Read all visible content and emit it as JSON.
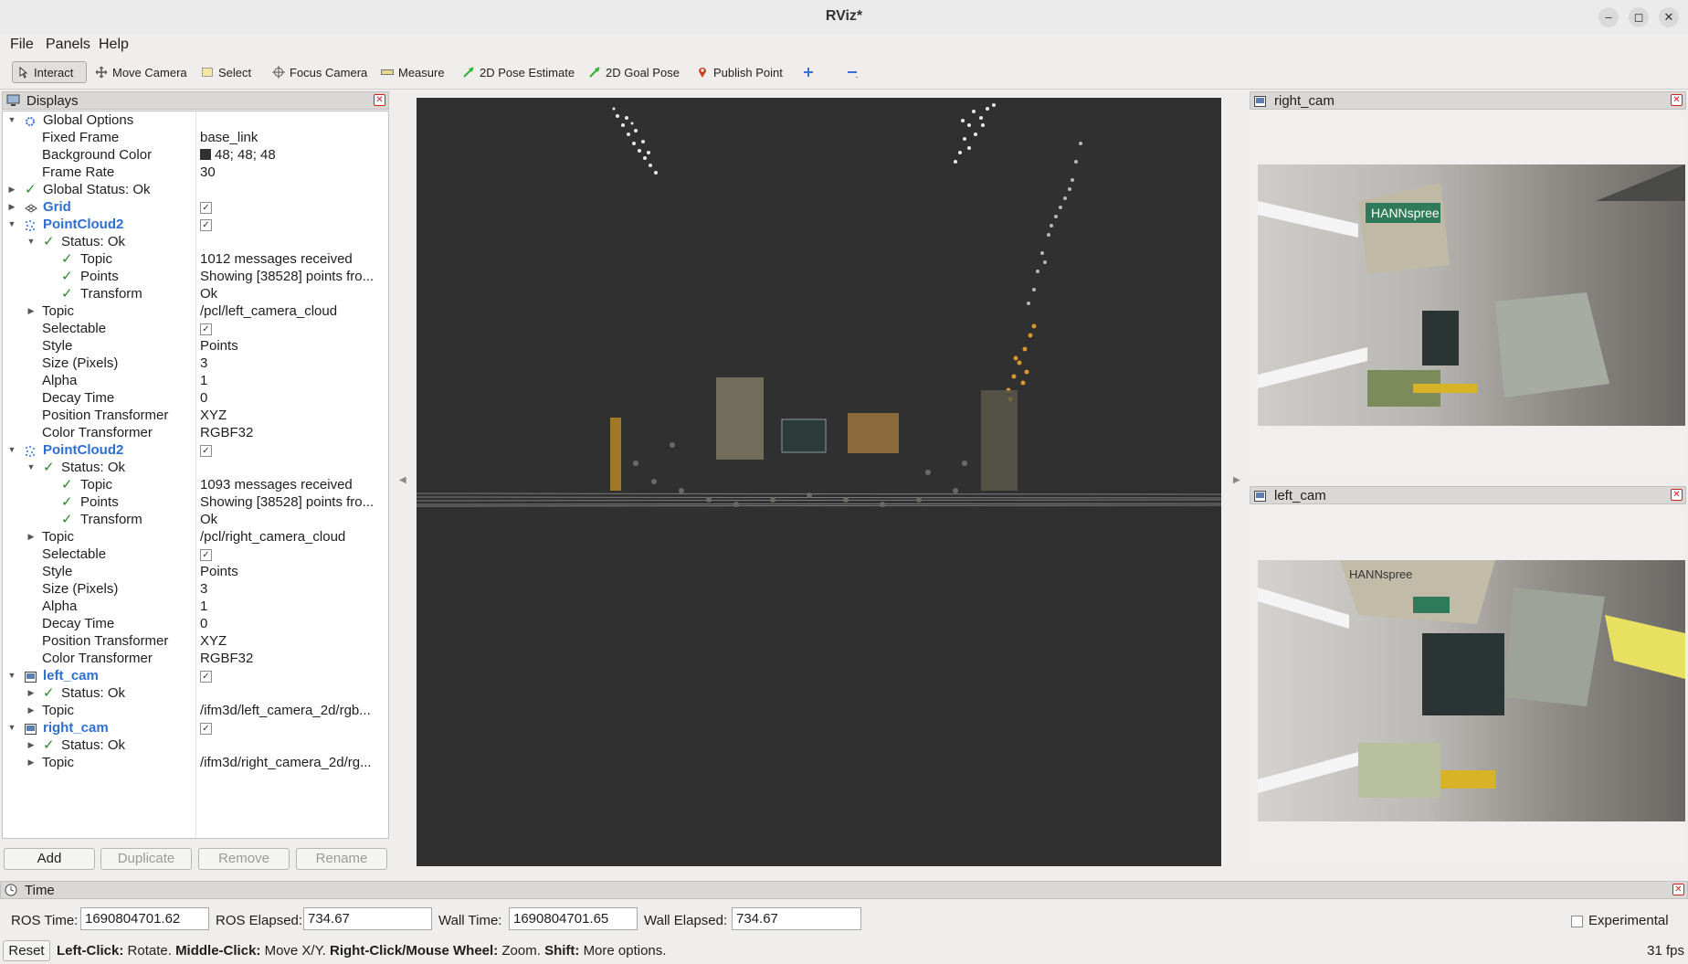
{
  "window": {
    "title": "RViz*"
  },
  "menu": [
    "File",
    "Panels",
    "Help"
  ],
  "toolbar": {
    "interact": "Interact",
    "move_camera": "Move Camera",
    "select": "Select",
    "focus_camera": "Focus Camera",
    "measure": "Measure",
    "pose_estimate": "2D Pose Estimate",
    "goal_pose": "2D Goal Pose",
    "publish_point": "Publish Point"
  },
  "displays": {
    "title": "Displays",
    "rows": [
      {
        "label": "Global Options",
        "value": ""
      },
      {
        "label": "Fixed Frame",
        "value": "base_link"
      },
      {
        "label": "Background Color",
        "value": "48; 48; 48"
      },
      {
        "label": "Frame Rate",
        "value": "30"
      },
      {
        "label": "Global Status: Ok",
        "value": ""
      },
      {
        "label": "Grid",
        "value": ""
      },
      {
        "label": "PointCloud2",
        "value": ""
      },
      {
        "label": "Status: Ok",
        "value": ""
      },
      {
        "label": "Topic",
        "value": "1012 messages received"
      },
      {
        "label": "Points",
        "value": "Showing [38528] points fro..."
      },
      {
        "label": "Transform",
        "value": "Ok"
      },
      {
        "label": "Topic",
        "value": "/pcl/left_camera_cloud"
      },
      {
        "label": "Selectable",
        "value": ""
      },
      {
        "label": "Style",
        "value": "Points"
      },
      {
        "label": "Size (Pixels)",
        "value": "3"
      },
      {
        "label": "Alpha",
        "value": "1"
      },
      {
        "label": "Decay Time",
        "value": "0"
      },
      {
        "label": "Position Transformer",
        "value": "XYZ"
      },
      {
        "label": "Color Transformer",
        "value": "RGBF32"
      },
      {
        "label": "PointCloud2",
        "value": ""
      },
      {
        "label": "Status: Ok",
        "value": ""
      },
      {
        "label": "Topic",
        "value": "1093 messages received"
      },
      {
        "label": "Points",
        "value": "Showing [38528] points fro..."
      },
      {
        "label": "Transform",
        "value": "Ok"
      },
      {
        "label": "Topic",
        "value": "/pcl/right_camera_cloud"
      },
      {
        "label": "Selectable",
        "value": ""
      },
      {
        "label": "Style",
        "value": "Points"
      },
      {
        "label": "Size (Pixels)",
        "value": "3"
      },
      {
        "label": "Alpha",
        "value": "1"
      },
      {
        "label": "Decay Time",
        "value": "0"
      },
      {
        "label": "Position Transformer",
        "value": "XYZ"
      },
      {
        "label": "Color Transformer",
        "value": "RGBF32"
      },
      {
        "label": "left_cam",
        "value": ""
      },
      {
        "label": "Status: Ok",
        "value": ""
      },
      {
        "label": "Topic",
        "value": "/ifm3d/left_camera_2d/rgb..."
      },
      {
        "label": "right_cam",
        "value": ""
      },
      {
        "label": "Status: Ok",
        "value": ""
      },
      {
        "label": "Topic",
        "value": "/ifm3d/right_camera_2d/rg..."
      }
    ],
    "buttons": {
      "add": "Add",
      "duplicate": "Duplicate",
      "remove": "Remove",
      "rename": "Rename"
    }
  },
  "right_cam": {
    "title": "right_cam",
    "sign": "HANNspree"
  },
  "left_cam": {
    "title": "left_cam",
    "sign": "HANNspree"
  },
  "time": {
    "title": "Time",
    "ros_time_label": "ROS Time:",
    "ros_time": "1690804701.62",
    "ros_elapsed_label": "ROS Elapsed:",
    "ros_elapsed": "734.67",
    "wall_time_label": "Wall Time:",
    "wall_time": "1690804701.65",
    "wall_elapsed_label": "Wall Elapsed:",
    "wall_elapsed": "734.67",
    "experimental": "Experimental"
  },
  "status": {
    "reset": "Reset",
    "left_click": "Left-Click:",
    "left_click_action": "Rotate.",
    "middle_click": "Middle-Click:",
    "middle_click_action": "Move X/Y.",
    "right_click": "Right-Click/Mouse Wheel:",
    "right_click_action": "Zoom.",
    "shift": "Shift:",
    "shift_action": "More options.",
    "fps": "31 fps"
  },
  "colors": {
    "viewport_bg": "#303030",
    "link_blue": "#2f6fd1",
    "ok_green": "#2a8a2a"
  }
}
